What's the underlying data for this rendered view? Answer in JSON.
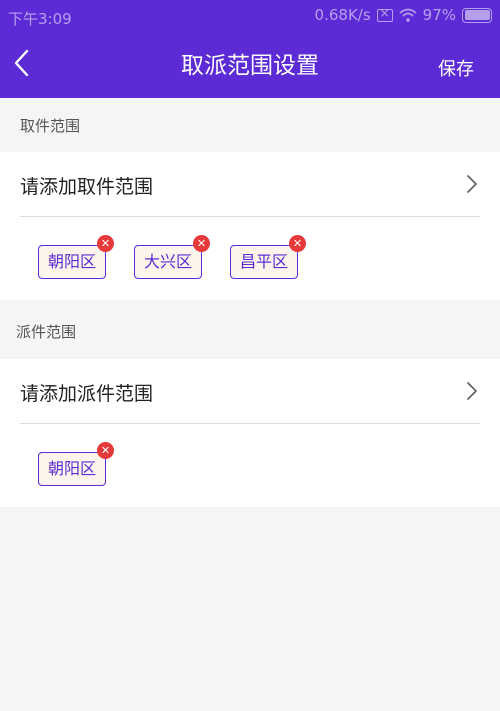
{
  "status_bar": {
    "time": "下午3:09",
    "network_speed": "0.68K/s",
    "battery": "97%"
  },
  "nav": {
    "title": "取派范围设置",
    "save_label": "保存"
  },
  "pickup": {
    "section_label": "取件范围",
    "add_label": "请添加取件范围",
    "tags": [
      "朝阳区",
      "大兴区",
      "昌平区"
    ]
  },
  "dispatch": {
    "section_label": "派件范围",
    "add_label": "请添加派件范围",
    "tags": [
      "朝阳区"
    ]
  },
  "colors": {
    "brand": "#5c2bd6",
    "remove_badge": "#e63a3a",
    "tag_background": "#fdf4ec"
  }
}
